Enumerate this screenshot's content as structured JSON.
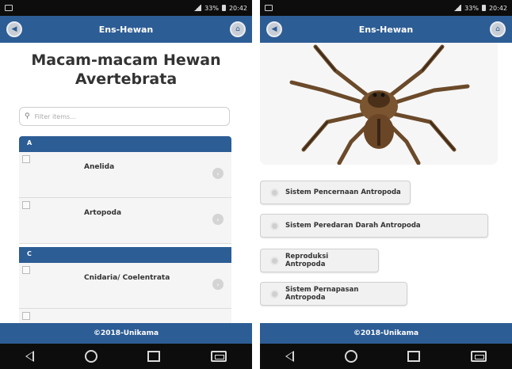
{
  "left": {
    "status_time": "20:42",
    "status_battery": "33%",
    "header_title": "Ens-Hewan",
    "page_title": "Macam-macam Hewan Avertebrata",
    "filter_placeholder": "Filter items...",
    "dividers": [
      "A",
      "C"
    ],
    "items": [
      {
        "label": "Anelida"
      },
      {
        "label": "Artopoda"
      },
      {
        "label": "Cnidaria/ Coelentrata"
      }
    ],
    "footer": "©2018-Unikama"
  },
  "right": {
    "status_time": "20:42",
    "status_battery": "33%",
    "header_title": "Ens-Hewan",
    "image_subject": "spider",
    "topics": [
      {
        "label": "Sistem Pencernaan Antropoda"
      },
      {
        "label": "Sistem Peredaran Darah Antropoda"
      },
      {
        "label": "Reproduksi Antropoda"
      },
      {
        "label": "Sistem Pernapasan Antropoda"
      }
    ],
    "footer": "©2018-Unikama"
  },
  "colors": {
    "header_blue": "#2d5d95",
    "status_black": "#0d0d0d"
  },
  "icons": [
    "back-circle-icon",
    "home-circle-icon",
    "search-icon",
    "chevron-right-icon",
    "radio-icon",
    "nav-back-icon",
    "nav-home-icon",
    "nav-recent-icon",
    "nav-menu-icon"
  ]
}
